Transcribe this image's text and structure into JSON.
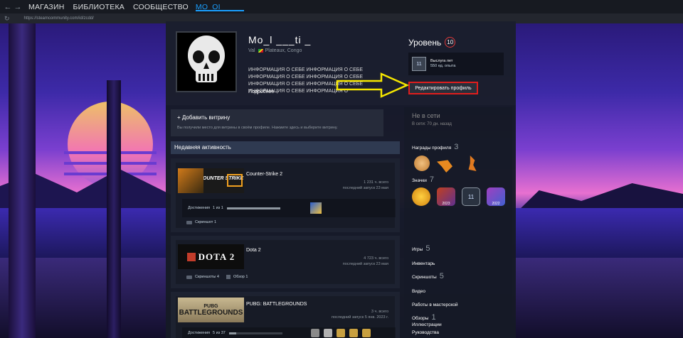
{
  "nav": {
    "back": "←",
    "forward": "→",
    "links": [
      "МАГАЗИН",
      "БИБЛИОТЕКА",
      "СООБЩЕСТВО"
    ],
    "active_link": "MO_OI__",
    "reload": "↻",
    "url": "https://steamcommunity.com/id/zcdd/"
  },
  "profile": {
    "persona_name": "Mo_l  ___ti _",
    "real_name": "Val",
    "location": "Plateaux, Congo",
    "summary": "ИНФОРМАЦИЯ О СЕБЕ ИНФОРМАЦИЯ О СЕБЕ ИНФОРМАЦИЯ О СЕБЕ ИНФОРМАЦИЯ О СЕБЕ ИНФОРМАЦИЯ О СЕБЕ ИНФОРМАЦИЯ О СЕБЕ ИНФОРМАЦИЯ О СЕБЕ ИНФОРМАЦИЯ О",
    "more_link": "Подробнее"
  },
  "level": {
    "title": "Уровень",
    "value": "10",
    "badge_value": "11",
    "badge_name": "Выслуга лет",
    "badge_xp": "550 ед. опыта"
  },
  "edit_button": "Редактировать профиль",
  "showcase": {
    "title": "+ Добавить витрину",
    "desc": "Вы получили место для витрины в своём профиле. Нажмите здесь и выберите витрину."
  },
  "activity": {
    "title": "Недавняя активность",
    "games": [
      {
        "name": "Counter-Strike 2",
        "capsule": "COUNTER STRIKE 2",
        "hours": "1 231 ч. всего",
        "last": "последний запуск 23 мая",
        "achievements_label": "Достижения",
        "achievements_count": "1 из 1",
        "achievements_progress": 1.0,
        "screenshots": "Скриншот 1"
      },
      {
        "name": "Dota 2",
        "capsule": "DOTA 2",
        "hours": "4 723 ч. всего",
        "last": "последний запуск 23 мая",
        "screenshots": "Скриншоты 4",
        "reviews": "Обзор 1"
      },
      {
        "name": "PUBG: BATTLEGROUNDS",
        "capsule_top": "PUBG",
        "capsule": "BATTLEGROUNDS",
        "hours": "3 ч. всего",
        "last": "последний запуск 5 янв. 2023 г.",
        "achievements_label": "Достижения",
        "achievements_count": "5 из 37",
        "achievements_progress": 0.135
      }
    ]
  },
  "sidebar": {
    "status": "Не в сети",
    "last_online": "В сети: 70 дн. назад",
    "awards_label": "Награды профиля",
    "awards_count": "3",
    "badges_label": "Значки",
    "badges_count": "7",
    "badge_years": [
      "2023",
      "11",
      "2022"
    ],
    "games_label": "Игры",
    "games_count": "5",
    "inventory": "Инвентарь",
    "screenshots_label": "Скриншоты",
    "screenshots_count": "5",
    "videos": "Видео",
    "workshop": "Работы в мастерской",
    "reviews_label": "Обзоры",
    "reviews_count": "1",
    "guides": "Руководства",
    "artwork": "Иллюстрации"
  },
  "colors": {
    "accent_blue": "#1a9fff",
    "edit_border": "#e01d1d",
    "arrow": "#f5e600",
    "level_ring": "#e23b3b"
  }
}
